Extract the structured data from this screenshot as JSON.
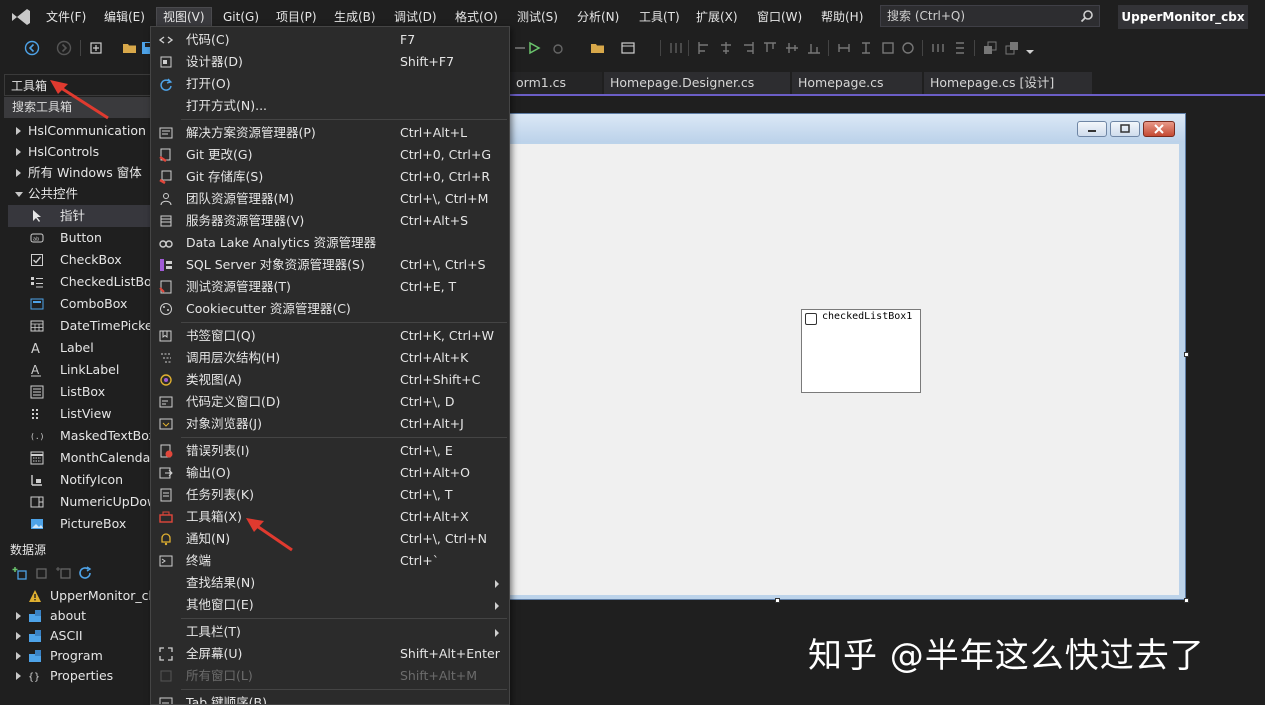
{
  "menubar": {
    "items": [
      "文件(F)",
      "编辑(E)",
      "视图(V)",
      "Git(G)",
      "项目(P)",
      "生成(B)",
      "调试(D)",
      "格式(O)",
      "测试(S)",
      "分析(N)",
      "工具(T)",
      "扩展(X)",
      "窗口(W)",
      "帮助(H)"
    ],
    "active_item": "视图(V)",
    "search_placeholder": "搜索 (Ctrl+Q)",
    "solution_name": "UpperMonitor_cbx"
  },
  "document_tabs": [
    "orm1.cs",
    "Homepage.Designer.cs",
    "Homepage.cs",
    "Homepage.cs [设计]"
  ],
  "toolbox": {
    "title": "工具箱",
    "search_label": "搜索工具箱",
    "categories": [
      {
        "label": "HslCommunication",
        "expanded": false
      },
      {
        "label": "HslControls",
        "expanded": false
      },
      {
        "label": "所有 Windows 窗体",
        "expanded": false
      },
      {
        "label": "公共控件",
        "expanded": true
      }
    ],
    "controls": [
      {
        "label": "指针",
        "icon": "pointer-icon",
        "selected": true
      },
      {
        "label": "Button",
        "icon": "button-icon"
      },
      {
        "label": "CheckBox",
        "icon": "checkbox-icon"
      },
      {
        "label": "CheckedListBox",
        "icon": "checkedlistbox-icon"
      },
      {
        "label": "ComboBox",
        "icon": "combobox-icon"
      },
      {
        "label": "DateTimePicker",
        "icon": "datetimepicker-icon"
      },
      {
        "label": "Label",
        "icon": "label-icon"
      },
      {
        "label": "LinkLabel",
        "icon": "linklabel-icon"
      },
      {
        "label": "ListBox",
        "icon": "listbox-icon"
      },
      {
        "label": "ListView",
        "icon": "listview-icon"
      },
      {
        "label": "MaskedTextBox",
        "icon": "maskedtextbox-icon"
      },
      {
        "label": "MonthCalendar",
        "icon": "monthcalendar-icon"
      },
      {
        "label": "NotifyIcon",
        "icon": "notifyicon-icon"
      },
      {
        "label": "NumericUpDown",
        "icon": "numericupdown-icon"
      },
      {
        "label": "PictureBox",
        "icon": "picturebox-icon"
      }
    ]
  },
  "data_sources": {
    "title": "数据源",
    "items": [
      {
        "label": "UpperMonitor_cbx",
        "icon": "warning-icon",
        "expandable": false
      },
      {
        "label": "about",
        "icon": "class-icon",
        "expandable": true
      },
      {
        "label": "ASCII",
        "icon": "class-icon",
        "expandable": true
      },
      {
        "label": "Program",
        "icon": "class-icon",
        "expandable": true
      },
      {
        "label": "Properties",
        "icon": "namespace-icon",
        "expandable": true
      }
    ]
  },
  "designer": {
    "control_text": "checkedListBox1"
  },
  "view_menu": {
    "items": [
      {
        "label": "代码(C)",
        "shortcut": "F7",
        "icon": "code-icon"
      },
      {
        "label": "设计器(D)",
        "shortcut": "Shift+F7",
        "icon": "designer-icon"
      },
      {
        "label": "打开(O)",
        "shortcut": "",
        "icon": "open-icon"
      },
      {
        "label": "打开方式(N)...",
        "shortcut": "",
        "icon": ""
      },
      {
        "sep": true
      },
      {
        "label": "解决方案资源管理器(P)",
        "shortcut": "Ctrl+Alt+L",
        "icon": "solution-explorer-icon"
      },
      {
        "label": "Git 更改(G)",
        "shortcut": "Ctrl+0, Ctrl+G",
        "icon": "git-changes-icon"
      },
      {
        "label": "Git 存储库(S)",
        "shortcut": "Ctrl+0, Ctrl+R",
        "icon": "git-repository-icon"
      },
      {
        "label": "团队资源管理器(M)",
        "shortcut": "Ctrl+\\, Ctrl+M",
        "icon": "team-explorer-icon"
      },
      {
        "label": "服务器资源管理器(V)",
        "shortcut": "Ctrl+Alt+S",
        "icon": "server-explorer-icon"
      },
      {
        "label": "Data Lake Analytics 资源管理器",
        "shortcut": "",
        "icon": "data-lake-icon"
      },
      {
        "label": "SQL Server 对象资源管理器(S)",
        "shortcut": "Ctrl+\\, Ctrl+S",
        "icon": "sql-server-icon"
      },
      {
        "label": "测试资源管理器(T)",
        "shortcut": "Ctrl+E, T",
        "icon": "test-explorer-icon"
      },
      {
        "label": "Cookiecutter 资源管理器(C)",
        "shortcut": "",
        "icon": "cookiecutter-icon"
      },
      {
        "sep": true
      },
      {
        "label": "书签窗口(Q)",
        "shortcut": "Ctrl+K, Ctrl+W",
        "icon": "bookmark-icon"
      },
      {
        "label": "调用层次结构(H)",
        "shortcut": "Ctrl+Alt+K",
        "icon": "call-hierarchy-icon"
      },
      {
        "label": "类视图(A)",
        "shortcut": "Ctrl+Shift+C",
        "icon": "class-view-icon"
      },
      {
        "label": "代码定义窗口(D)",
        "shortcut": "Ctrl+\\, D",
        "icon": "code-definition-icon"
      },
      {
        "label": "对象浏览器(J)",
        "shortcut": "Ctrl+Alt+J",
        "icon": "object-browser-icon"
      },
      {
        "sep": true
      },
      {
        "label": "错误列表(I)",
        "shortcut": "Ctrl+\\, E",
        "icon": "error-list-icon"
      },
      {
        "label": "输出(O)",
        "shortcut": "Ctrl+Alt+O",
        "icon": "output-icon"
      },
      {
        "label": "任务列表(K)",
        "shortcut": "Ctrl+\\, T",
        "icon": "task-list-icon"
      },
      {
        "label": "工具箱(X)",
        "shortcut": "Ctrl+Alt+X",
        "icon": "toolbox-icon"
      },
      {
        "label": "通知(N)",
        "shortcut": "Ctrl+\\, Ctrl+N",
        "icon": "notification-icon"
      },
      {
        "label": "终端",
        "shortcut": "Ctrl+`",
        "icon": "terminal-icon"
      },
      {
        "label": "查找结果(N)",
        "shortcut": "",
        "icon": "",
        "submenu": true
      },
      {
        "label": "其他窗口(E)",
        "shortcut": "",
        "icon": "",
        "submenu": true
      },
      {
        "sep": true
      },
      {
        "label": "工具栏(T)",
        "shortcut": "",
        "icon": "",
        "submenu": true
      },
      {
        "label": "全屏幕(U)",
        "shortcut": "Shift+Alt+Enter",
        "icon": "fullscreen-icon"
      },
      {
        "label": "所有窗口(L)",
        "shortcut": "Shift+Alt+M",
        "icon": "all-windows-icon",
        "disabled": true
      },
      {
        "sep": true
      },
      {
        "label": "Tab 键顺序(B)",
        "shortcut": "",
        "icon": "tab-order-icon"
      }
    ]
  },
  "watermark": "知乎 @半年这么快过去了",
  "colors": {
    "background": "#1f1f1f",
    "menu_background": "#2b2b2b",
    "accent": "#6b5ec6",
    "annotation_arrow": "#e03a2f",
    "form_client": "#f0f0f0"
  }
}
